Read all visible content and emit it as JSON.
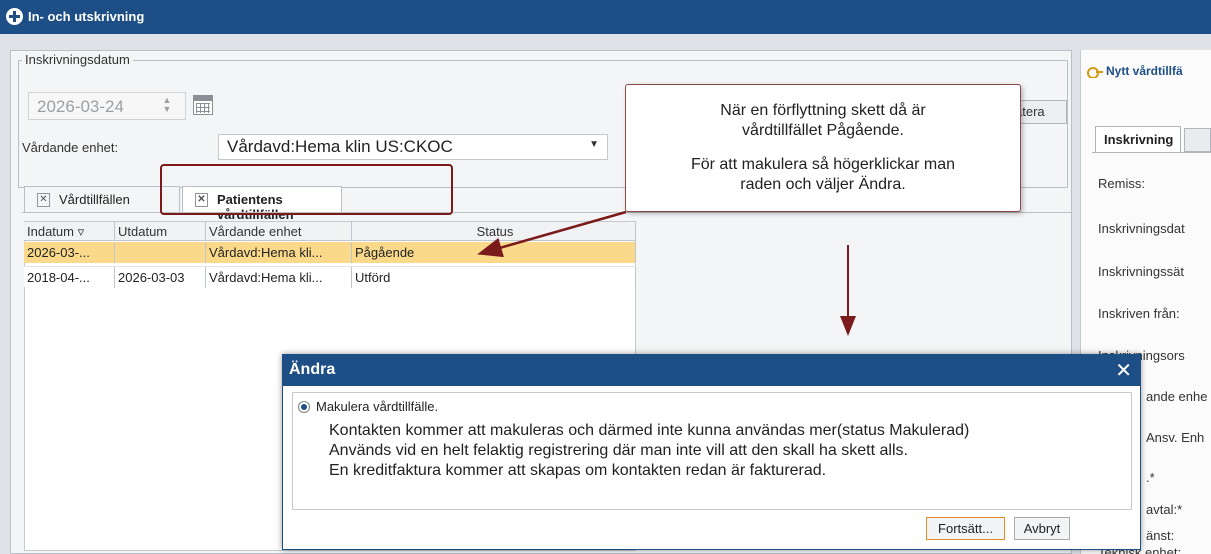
{
  "window": {
    "title": "In- och utskrivning"
  },
  "admission": {
    "group_label": "Inskrivningsdatum",
    "date_value": "2026-03-24",
    "unit_label": "Vårdande enhet:",
    "unit_value": "Vårdavd:Hema klin US:CKOC",
    "update_button_fragment": "atera"
  },
  "tabs": [
    {
      "label": "Vårdtillfällen"
    },
    {
      "label": "Patientens vårdtillfällen"
    }
  ],
  "grid": {
    "headers": [
      "Indatum",
      "Utdatum",
      "Vårdande enhet",
      "Status"
    ],
    "rows": [
      {
        "indatum": "2026-03-...",
        "utdatum": "",
        "enhet": "Vårdavd:Hema kli...",
        "status": "Pågående"
      },
      {
        "indatum": "2018-04-...",
        "utdatum": "2026-03-03",
        "enhet": "Vårdavd:Hema kli...",
        "status": "Utförd"
      }
    ]
  },
  "callout": {
    "line1": "När en förflyttning skett då är",
    "line2": "vårdtillfället Pågående.",
    "line3": "För att makulera så högerklickar man",
    "line4": "raden och väljer Ändra."
  },
  "right_panel": {
    "title": "Nytt vårdtillfä",
    "tab": "Inskrivning",
    "labels": [
      "Remiss:",
      "Inskrivningsdat",
      "Inskrivningssät",
      "Inskriven från:",
      "Inskrivningsors",
      "ande enhe",
      "Ansv. Enh",
      ".*",
      "avtal:*",
      "änst:",
      "Teknisk enhet:"
    ]
  },
  "dialog": {
    "title": "Ändra",
    "close_glyph": "✕",
    "option_label": "Makulera vårdtillfälle.",
    "description": [
      "Kontakten kommer att makuleras och därmed inte kunna användas mer(status Makulerad)",
      "Används vid en helt felaktig registrering där man inte vill att den skall ha skett alls.",
      "En kreditfaktura kommer att skapas om kontakten redan är fakturerad."
    ],
    "continue_label": "Fortsätt...",
    "cancel_label": "Avbryt"
  },
  "colors": {
    "titlebar": "#1d4f86",
    "selected_row": "#fbd98a",
    "annotation": "#7a1a1a",
    "default_button_border": "#e08c2a"
  }
}
